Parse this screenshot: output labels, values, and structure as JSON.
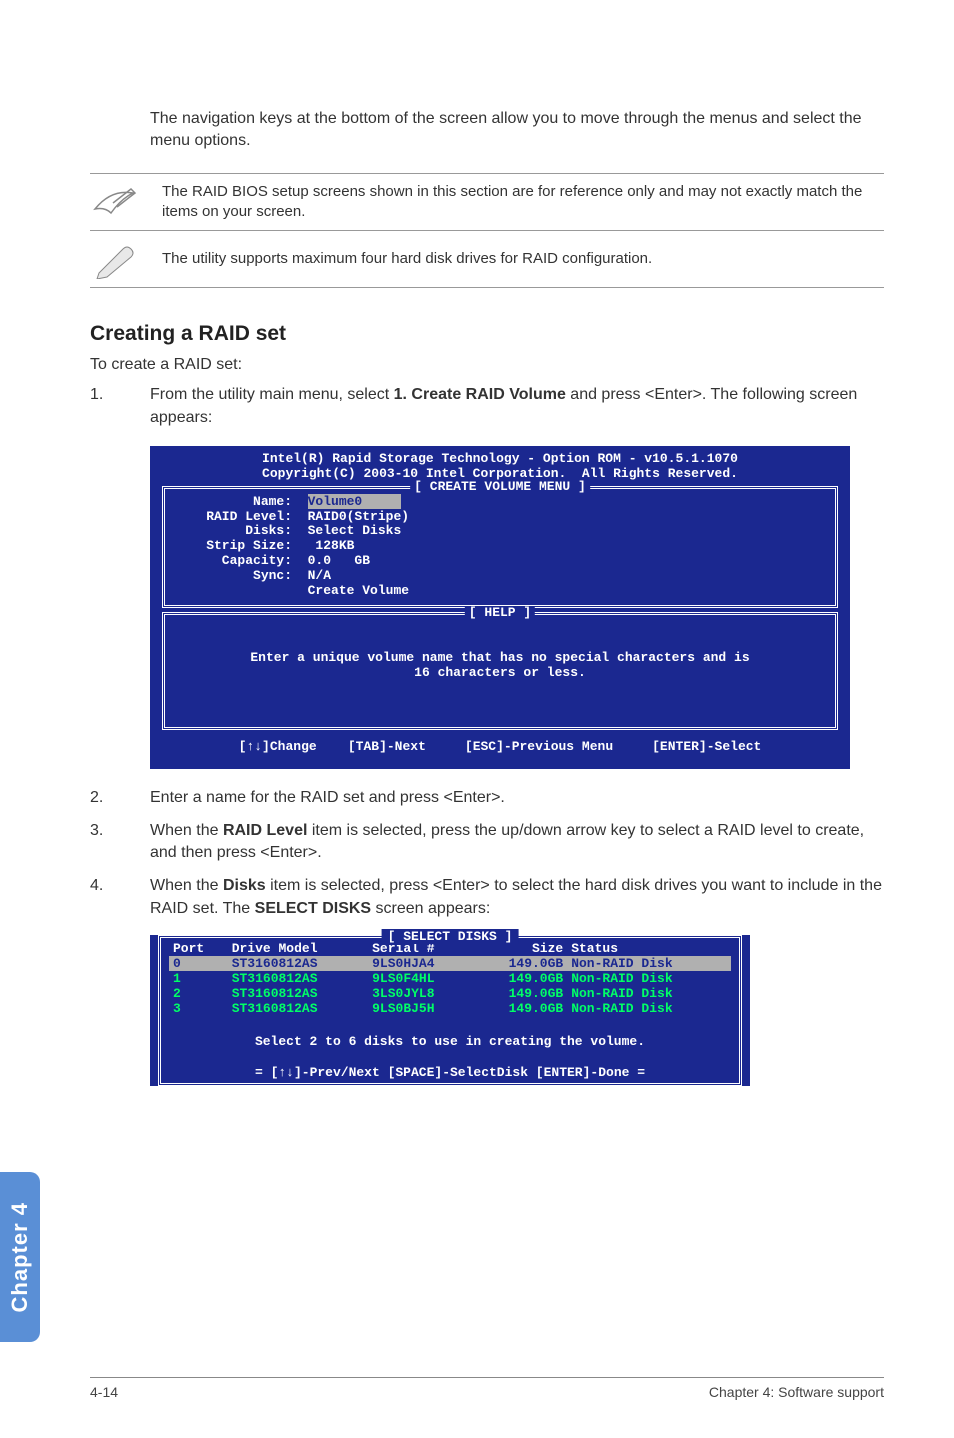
{
  "intro_text": "The navigation keys at the bottom of the screen allow you to move through the menus and select the menu options.",
  "note1": "The RAID BIOS setup screens shown in this section are for reference only and may not exactly match the items on your screen.",
  "note2": "The utility supports maximum four hard disk drives for RAID configuration.",
  "heading": "Creating a RAID set",
  "subtext": "To create a RAID set:",
  "step1_num": "1.",
  "step1_pre": "From the utility main menu, select ",
  "step1_bold": "1. Create RAID Volume",
  "step1_post": " and press <Enter>. The following screen appears:",
  "bios": {
    "title1": "Intel(R) Rapid Storage Technology - Option ROM - v10.5.1.1070",
    "title2": "Copyright(C) 2003-10 Intel Corporation.  All Rights Reserved.",
    "frame_title": "[ CREATE VOLUME MENU ]",
    "kv": {
      "name_label": "          Name:  ",
      "name_value": "Volume0",
      "raid_label": "    RAID Level:  ",
      "raid_value": "RAID0(Stripe)",
      "disks_label": "         Disks:  ",
      "disks_value": "Select Disks",
      "strip_label": "    Strip Size:  ",
      "strip_value": " 128KB",
      "cap_label": "      Capacity:  ",
      "cap_value": "0.0   GB",
      "sync_label": "          Sync:  ",
      "sync_value": "N/A",
      "create_label": "                 ",
      "create_value": "Create Volume"
    },
    "help_title": "[ HELP ]",
    "help_text": "Enter a unique volume name that has no special characters and is\n16 characters or less.",
    "footer": "[↑↓]Change    [TAB]-Next     [ESC]-Previous Menu     [ENTER]-Select"
  },
  "step2_num": "2.",
  "step2_text": "Enter a name for the RAID set and press <Enter>.",
  "step3_num": "3.",
  "step3_pre": "When the ",
  "step3_bold": "RAID Level",
  "step3_post": " item is selected, press the up/down arrow key to select a RAID level to create, and then press <Enter>.",
  "step4_num": "4.",
  "step4_pre": "When the ",
  "step4_bold1": "Disks",
  "step4_mid": " item is selected, press <Enter> to select the hard disk drives you want to include in the RAID set. The ",
  "step4_bold2": "SELECT DISKS",
  "step4_post": " screen appears:",
  "disks": {
    "frame_title": "[ SELECT DISKS ]",
    "headers": {
      "port": "Port",
      "model": "Drive Model",
      "serial": "Serial #",
      "size": "Size",
      "status": "Status"
    },
    "rows": [
      {
        "port": "0",
        "model": "ST3160812AS",
        "serial": "9LS0HJA4",
        "size": "149.0GB",
        "status": "Non-RAID Disk",
        "selected": true
      },
      {
        "port": "1",
        "model": "ST3160812AS",
        "serial": "9LS0F4HL",
        "size": "149.0GB",
        "status": "Non-RAID Disk",
        "selected": false
      },
      {
        "port": "2",
        "model": "ST3160812AS",
        "serial": "3LS0JYL8",
        "size": "149.0GB",
        "status": "Non-RAID Disk",
        "selected": false
      },
      {
        "port": "3",
        "model": "ST3160812AS",
        "serial": "9LS0BJ5H",
        "size": "149.0GB",
        "status": "Non-RAID Disk",
        "selected": false
      }
    ],
    "msg": "Select 2 to 6 disks to use in creating the volume.",
    "footer": "[↑↓]-Prev/Next [SPACE]-SelectDisk [ENTER]-Done"
  },
  "sidetab": "Chapter 4",
  "footer_left": "4-14",
  "footer_right": "Chapter 4: Software support"
}
